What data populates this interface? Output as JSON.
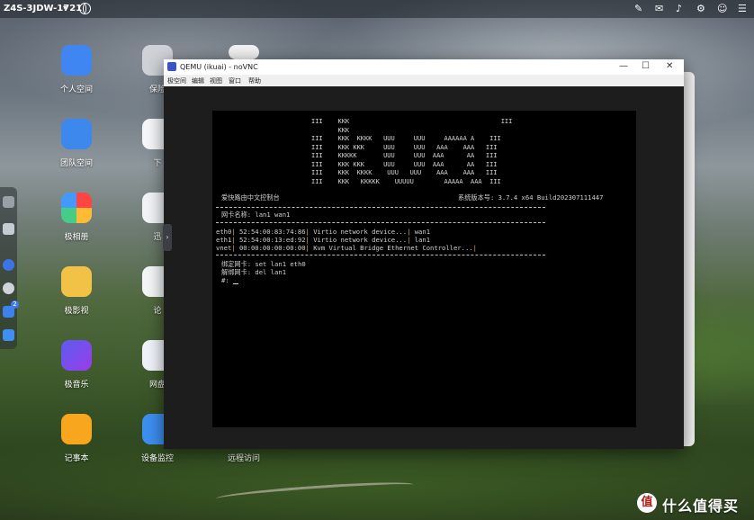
{
  "topbar": {
    "device_name": "Z4S-3JDW-1721",
    "caret": "▾",
    "icons": [
      "pin-icon",
      "mail-icon",
      "bell-icon",
      "settings-icon",
      "user-icon"
    ]
  },
  "dock": {
    "badge": "2"
  },
  "desktop": {
    "apps": [
      {
        "label": "个人空间",
        "icon": "folder-icon",
        "color": "#3f86f2"
      },
      {
        "label": "保险",
        "icon": "safe-icon",
        "color": "#cfd3d8"
      },
      {
        "label": "团队空间",
        "icon": "team-folder-icon",
        "color": "#3c88ec"
      },
      {
        "label": "下",
        "icon": "download-icon",
        "color": "#f5f7fa"
      },
      {
        "label": "极相册",
        "icon": "photos-icon",
        "color": "#ffffff"
      },
      {
        "label": "迅",
        "icon": "thunder-icon",
        "color": "#f2f4f8"
      },
      {
        "label": "极影视",
        "icon": "video-icon",
        "color": "#f2c246"
      },
      {
        "label": "论",
        "icon": "forum-icon",
        "color": "#f4f6f8"
      },
      {
        "label": "极音乐",
        "icon": "music-icon",
        "color": "#6b4be8"
      },
      {
        "label": "网盘",
        "icon": "cloud-icon",
        "color": "#f0f4fa"
      },
      {
        "label": "记事本",
        "icon": "notepad-icon",
        "color": "#f7a61e"
      },
      {
        "label": "设备监控",
        "icon": "monitor-icon",
        "color": "#3d8ff0"
      },
      {
        "label": "远程访问",
        "icon": "remote-icon",
        "color": "#ffffff"
      }
    ]
  },
  "qemu": {
    "title": "QEMU (ikuai) - noVNC",
    "controls": {
      "minimize": "—",
      "maximize": "☐",
      "close": "✕"
    },
    "menu": [
      "极空间",
      "编辑",
      "视图",
      "窗口",
      "帮助"
    ],
    "terminal": {
      "ascii_art": [
        "III    KKK                                        III",
        "       KKK",
        "III    KKK  KKKK   UUU     UUU     AAAAAA A    III",
        "III    KKK KKK     UUU     UUU   AAA    AAA   III",
        "III    KKKKK       UUU     UUU  AAA      AA   III",
        "III    KKK KKK     UUU     UUU  AAA      AA   III",
        "III    KKK  KKKK    UUU   UUU    AAA    AAA   III",
        "III    KKK   KKKKK    UUUUU        AAAAA  AAA  III"
      ],
      "console_title": "爱快路由中文控制台",
      "version": "系统版本号: 3.7.4 x64 Build202307111447",
      "nic_header": "网卡名称: lan1 wan1",
      "nics": [
        {
          "name": "eth0",
          "mac": "52:54:00:83:74:86",
          "desc": "Virtio network device...",
          "bind": "wan1"
        },
        {
          "name": "eth1",
          "mac": "52:54:00:13:ed:92",
          "desc": "Virtio network device...",
          "bind": "lan1"
        },
        {
          "name": "vnet",
          "mac": "00:00:00:00:00:00",
          "desc": "Kvm Virtual Bridge Ethernet Controller...",
          "bind": ""
        }
      ],
      "bind_help": "绑定网卡: set lan1 eth0",
      "unbind_help": "解绑网卡: del lan1",
      "prompt": "#:"
    }
  },
  "watermark": {
    "logo": "值",
    "text": "什么值得买"
  }
}
